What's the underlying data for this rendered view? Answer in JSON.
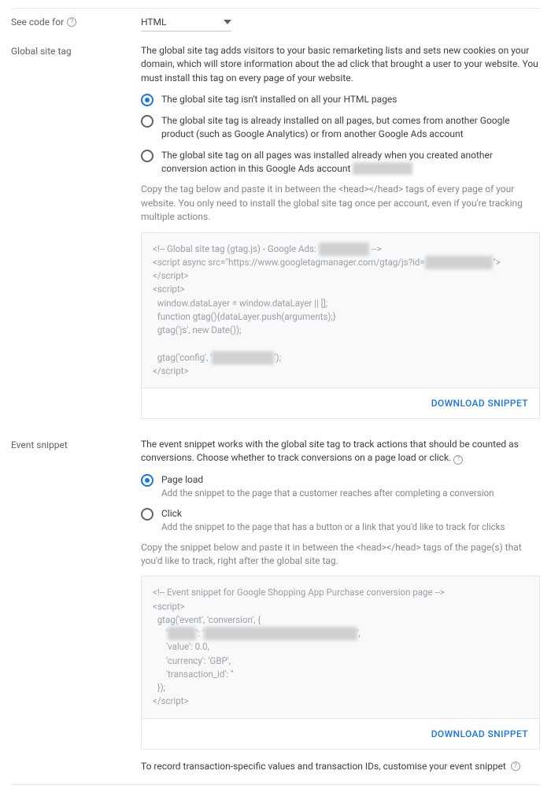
{
  "see_code": {
    "label": "See code for",
    "value": "HTML"
  },
  "global_tag": {
    "label": "Global site tag",
    "desc": "The global site tag adds visitors to your basic remarketing lists and sets new cookies on your domain, which will store information about the ad click that brought a user to your website. You must install this tag on every page of your website.",
    "radios": [
      "The global site tag isn't installed on all your HTML pages",
      "The global site tag is already installed on all pages, but comes from another Google product (such as Google Analytics) or from another Google Ads account",
      "The global site tag on all pages was installed already when you created another conversion action in this Google Ads account"
    ],
    "copy_note": "Copy the tag below and paste it in between the <head></head> tags of every page of your website. You only need to install the global site tag once per account, even if you're tracking multiple actions.",
    "code": {
      "l1a": "<!-- Global site tag (gtag.js) - Google Ads: ",
      "l1b": " -->",
      "l2a": "<script async src=\"https://www.googletagmanager.com/gtag/js?id=",
      "l2b": "\"></script>",
      "l3": "<script>",
      "l4": "  window.dataLayer = window.dataLayer || [];",
      "l5": "  function gtag(){dataLayer.push(arguments);}",
      "l6": "  gtag('js', new Date());",
      "l7a": "  gtag('config', '",
      "l7b": "');",
      "l8": "</script>"
    },
    "download": "DOWNLOAD SNIPPET"
  },
  "event_snippet": {
    "label": "Event snippet",
    "desc": "The event snippet works with the global site tag to track actions that should be counted as conversions. Choose whether to track conversions on a page load or click.",
    "radios": [
      {
        "title": "Page load",
        "sub": "Add the snippet to the page that a customer reaches after completing a conversion"
      },
      {
        "title": "Click",
        "sub": "Add the snippet to the page that has a button or a link that you'd like to track for clicks"
      }
    ],
    "copy_note": "Copy the snippet below and paste it in between the <head></head> tags of the page(s) that you'd like to track, right after the global site tag.",
    "code": {
      "l1": "<!-- Event snippet for Google Shopping App Purchase conversion page -->",
      "l2": "<script>",
      "l3": "  gtag('event', 'conversion', {",
      "l4a": "      '",
      "l4b": "',",
      "l5": "      'value': 0.0,",
      "l6": "      'currency': 'GBP',",
      "l7": "      'transaction_id': ''",
      "l8": "  });",
      "l9": "</script>"
    },
    "download": "DOWNLOAD SNIPPET"
  },
  "footer_note": "To record transaction-specific values and transaction IDs, customise your event snippet"
}
